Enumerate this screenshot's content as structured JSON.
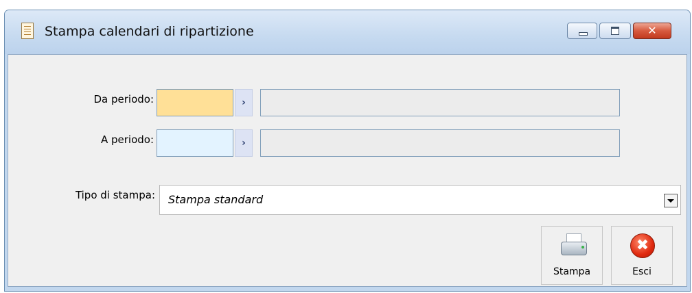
{
  "window": {
    "title": "Stampa calendari di ripartizione",
    "close_glyph": "✕"
  },
  "form": {
    "from_period": {
      "label": "Da periodo:",
      "value": "",
      "description": "",
      "color": "#ffe097"
    },
    "to_period": {
      "label": "A periodo:",
      "value": "",
      "description": "",
      "color": "#e3f3ff"
    },
    "print_type": {
      "label": "Tipo di stampa:",
      "value": "Stampa standard"
    }
  },
  "buttons": {
    "print": {
      "label": "Stampa",
      "icon": "printer-icon"
    },
    "exit": {
      "label": "Esci",
      "icon": "exit-icon",
      "glyph": "✖"
    }
  },
  "zoom_glyph": "›"
}
